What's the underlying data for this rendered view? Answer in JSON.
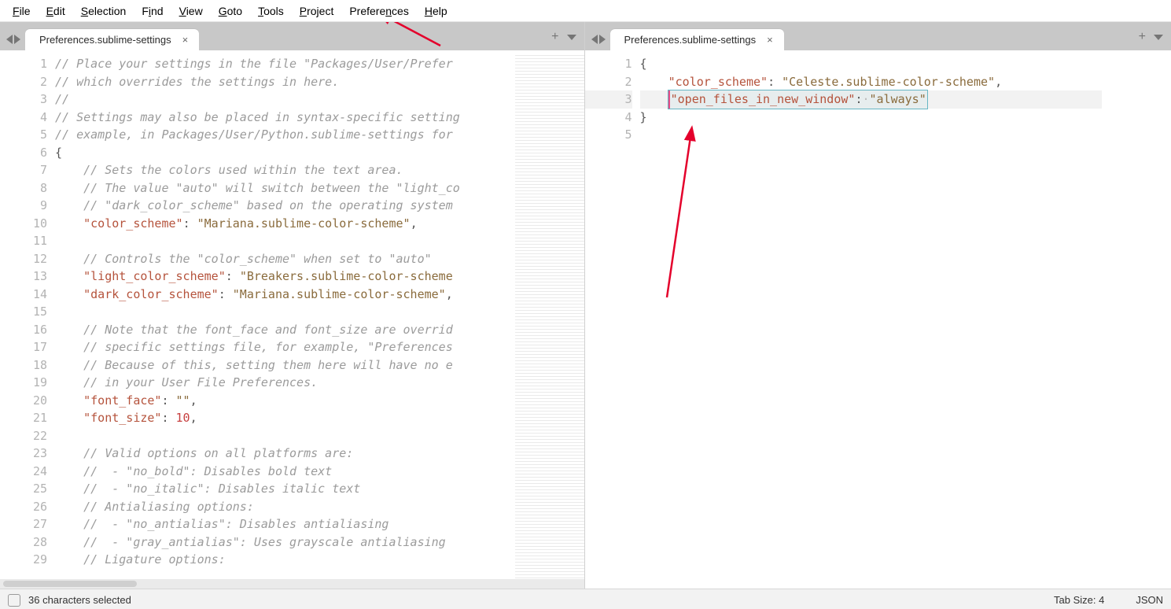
{
  "menus": {
    "file": "File",
    "edit": "Edit",
    "selection": "Selection",
    "find": "Find",
    "view": "View",
    "goto": "Goto",
    "tools": "Tools",
    "project": "Project",
    "preferences": "Preferences",
    "help": "Help"
  },
  "left_pane": {
    "tab_title": "Preferences.sublime-settings",
    "line_numbers": [
      "1",
      "2",
      "3",
      "4",
      "5",
      "6",
      "7",
      "8",
      "9",
      "10",
      "11",
      "12",
      "13",
      "14",
      "15",
      "16",
      "17",
      "18",
      "19",
      "20",
      "21",
      "22",
      "23",
      "24",
      "25",
      "26",
      "27",
      "28",
      "29"
    ],
    "lines_html": [
      "<span class='cm'>// Place your settings in the file \"Packages/User/Prefer</span>",
      "<span class='cm'>// which overrides the settings in here.</span>",
      "<span class='cm'>//</span>",
      "<span class='cm'>// Settings may also be placed in syntax-specific setting</span>",
      "<span class='cm'>// example, in Packages/User/Python.sublime-settings for </span>",
      "<span class='pun'>{</span>",
      "    <span class='cm'>// Sets the colors used within the text area.</span>",
      "    <span class='cm'>// The value \"auto\" will switch between the \"light_co</span>",
      "    <span class='cm'>// \"dark_color_scheme\" based on the operating system</span>",
      "    <span class='key'>\"color_scheme\"</span><span class='pun'>: </span><span class='str'>\"Mariana.sublime-color-scheme\"</span><span class='pun'>,</span>",
      "",
      "    <span class='cm'>// Controls the \"color_scheme\" when set to \"auto\"</span>",
      "    <span class='key'>\"light_color_scheme\"</span><span class='pun'>: </span><span class='str'>\"Breakers.sublime-color-scheme</span>",
      "    <span class='key'>\"dark_color_scheme\"</span><span class='pun'>: </span><span class='str'>\"Mariana.sublime-color-scheme\"</span><span class='pun'>,</span>",
      "",
      "    <span class='cm'>// Note that the font_face and font_size are overrid</span>",
      "    <span class='cm'>// specific settings file, for example, \"Preferences</span>",
      "    <span class='cm'>// Because of this, setting them here will have no e</span>",
      "    <span class='cm'>// in your User File Preferences.</span>",
      "    <span class='key'>\"font_face\"</span><span class='pun'>: </span><span class='str'>\"\"</span><span class='pun'>,</span>",
      "    <span class='key'>\"font_size\"</span><span class='pun'>: </span><span class='num'>10</span><span class='pun'>,</span>",
      "",
      "    <span class='cm'>// Valid options on all platforms are:</span>",
      "    <span class='cm'>//  - \"no_bold\": Disables bold text</span>",
      "    <span class='cm'>//  - \"no_italic\": Disables italic text</span>",
      "    <span class='cm'>// Antialiasing options:</span>",
      "    <span class='cm'>//  - \"no_antialias\": Disables antialiasing</span>",
      "    <span class='cm'>//  - \"gray_antialias\": Uses grayscale antialiasing</span>",
      "    <span class='cm'>// Ligature options:</span>"
    ]
  },
  "right_pane": {
    "tab_title": "Preferences.sublime-settings",
    "line_numbers": [
      "1",
      "2",
      "3",
      "4",
      "5"
    ],
    "lines_html": [
      "<span class='pun'>{</span>",
      "    <span class='key'>\"color_scheme\"</span><span class='pun'>: </span><span class='str'>\"Celeste.sublime-color-scheme\"</span><span class='pun'>,</span>",
      "    <span class='highlight-box'><span class='key'>\"open_files_in_new_window\"</span><span class='pun'>:</span><span class='ws'>·</span><span class='str'>\"always\"</span></span>",
      "<span class='pun'>}</span>",
      ""
    ],
    "current_line_index": 2
  },
  "statusbar": {
    "selection_text": "36 characters selected",
    "tab_size": "Tab Size: 4",
    "syntax": "JSON"
  }
}
